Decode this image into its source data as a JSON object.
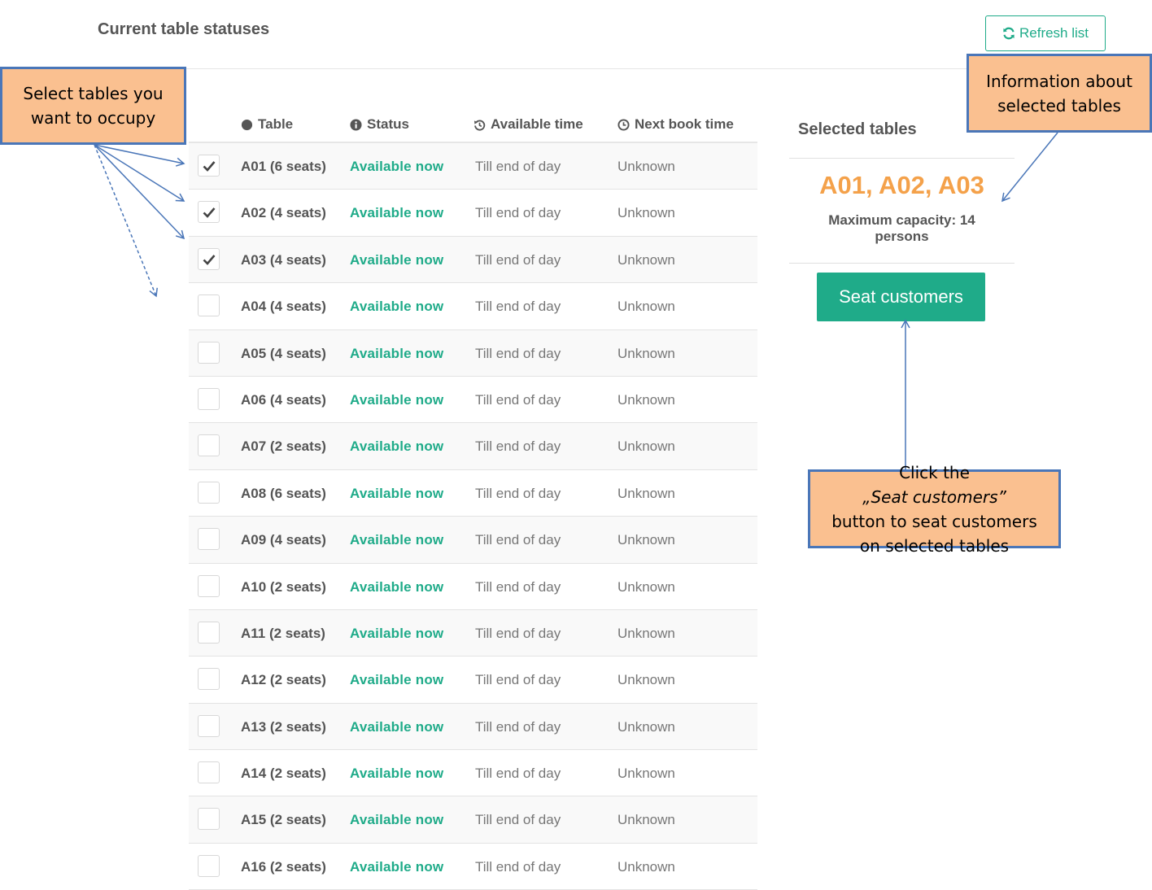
{
  "page": {
    "title": "Current table statuses",
    "refresh_label": "Refresh list"
  },
  "table": {
    "headers": {
      "table": "Table",
      "status": "Status",
      "available_time": "Available time",
      "next_book_time": "Next book time"
    },
    "rows": [
      {
        "name": "A01 (6 seats)",
        "status": "Available now",
        "available": "Till end of day",
        "next": "Unknown",
        "checked": true
      },
      {
        "name": "A02 (4 seats)",
        "status": "Available now",
        "available": "Till end of day",
        "next": "Unknown",
        "checked": true
      },
      {
        "name": "A03 (4 seats)",
        "status": "Available now",
        "available": "Till end of day",
        "next": "Unknown",
        "checked": true
      },
      {
        "name": "A04 (4 seats)",
        "status": "Available now",
        "available": "Till end of day",
        "next": "Unknown",
        "checked": false
      },
      {
        "name": "A05 (4 seats)",
        "status": "Available now",
        "available": "Till end of day",
        "next": "Unknown",
        "checked": false
      },
      {
        "name": "A06 (4 seats)",
        "status": "Available now",
        "available": "Till end of day",
        "next": "Unknown",
        "checked": false
      },
      {
        "name": "A07 (2 seats)",
        "status": "Available now",
        "available": "Till end of day",
        "next": "Unknown",
        "checked": false
      },
      {
        "name": "A08 (6 seats)",
        "status": "Available now",
        "available": "Till end of day",
        "next": "Unknown",
        "checked": false
      },
      {
        "name": "A09 (4 seats)",
        "status": "Available now",
        "available": "Till end of day",
        "next": "Unknown",
        "checked": false
      },
      {
        "name": "A10 (2 seats)",
        "status": "Available now",
        "available": "Till end of day",
        "next": "Unknown",
        "checked": false
      },
      {
        "name": "A11 (2 seats)",
        "status": "Available now",
        "available": "Till end of day",
        "next": "Unknown",
        "checked": false
      },
      {
        "name": "A12 (2 seats)",
        "status": "Available now",
        "available": "Till end of day",
        "next": "Unknown",
        "checked": false
      },
      {
        "name": "A13 (2 seats)",
        "status": "Available now",
        "available": "Till end of day",
        "next": "Unknown",
        "checked": false
      },
      {
        "name": "A14 (2 seats)",
        "status": "Available now",
        "available": "Till end of day",
        "next": "Unknown",
        "checked": false
      },
      {
        "name": "A15 (2 seats)",
        "status": "Available now",
        "available": "Till end of day",
        "next": "Unknown",
        "checked": false
      },
      {
        "name": "A16 (2 seats)",
        "status": "Available now",
        "available": "Till end of day",
        "next": "Unknown",
        "checked": false
      }
    ]
  },
  "selection": {
    "title": "Selected tables",
    "tables": "A01, A02, A03",
    "capacity": "Maximum capacity: 14 persons",
    "seat_label": "Seat customers"
  },
  "callouts": {
    "select": [
      "Select tables you",
      "want to occupy"
    ],
    "info": [
      "Information about",
      "selected tables"
    ],
    "seat": {
      "pre": "Click the ",
      "quoted": "„Seat customers”",
      "line2": "button to seat customers",
      "line3": "on selected tables"
    }
  },
  "colors": {
    "accent": "#1fab89",
    "selected_tables": "#f4a14a",
    "callout_fill": "#fac090",
    "callout_border": "#4a76b8"
  },
  "icons": {
    "refresh": "refresh-icon",
    "table_header": "circle-icon",
    "status_header": "info-icon",
    "available_header": "history-icon",
    "next_header": "clock-icon",
    "checkbox": "check-icon"
  }
}
